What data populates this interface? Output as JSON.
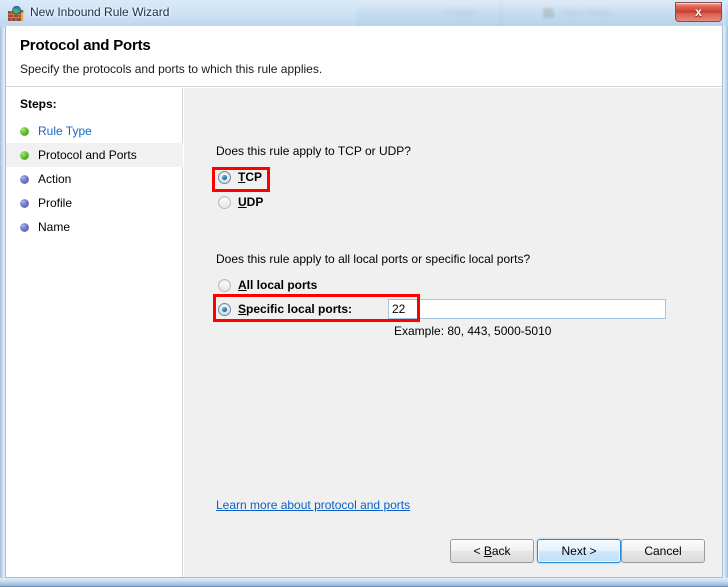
{
  "window": {
    "title": "New Inbound Rule Wizard",
    "icon": "firewall-globe-icon",
    "close_label": "x"
  },
  "background": {
    "blur_items": [
      {
        "text": "Public"
      },
      {
        "text": "New Rule..."
      }
    ]
  },
  "header": {
    "title": "Protocol and Ports",
    "subtitle": "Specify the protocols and ports to which this rule applies."
  },
  "sidebar": {
    "heading": "Steps:",
    "items": [
      {
        "label": "Rule Type",
        "state": "done",
        "current": false,
        "link": true
      },
      {
        "label": "Protocol and Ports",
        "state": "done",
        "current": true,
        "link": false
      },
      {
        "label": "Action",
        "state": "pending",
        "current": false,
        "link": false
      },
      {
        "label": "Profile",
        "state": "pending",
        "current": false,
        "link": false
      },
      {
        "label": "Name",
        "state": "pending",
        "current": false,
        "link": false
      }
    ]
  },
  "content": {
    "question_protocol": "Does this rule apply to TCP or UDP?",
    "protocol_options": [
      {
        "accel": "T",
        "rest": "CP",
        "checked": true
      },
      {
        "accel": "U",
        "rest": "DP",
        "checked": false
      }
    ],
    "question_ports": "Does this rule apply to all local ports or specific local ports?",
    "port_options": [
      {
        "accel": "A",
        "rest": "ll local ports",
        "checked": false
      },
      {
        "accel": "S",
        "rest": "pecific local ports:",
        "checked": true
      }
    ],
    "ports_value": "22",
    "ports_placeholder": "",
    "ports_example": "Example: 80, 443, 5000-5010",
    "learn_more": "Learn more about protocol and ports"
  },
  "annotations": {
    "accent_color": "#ff0000",
    "boxes": [
      {
        "name": "tcp-radio-highlight"
      },
      {
        "name": "specific-local-ports-highlight"
      }
    ]
  },
  "footer": {
    "back": {
      "pre": "< ",
      "accel": "B",
      "post": "ack"
    },
    "next": {
      "label": "Next >"
    },
    "cancel": {
      "label": "Cancel"
    }
  }
}
